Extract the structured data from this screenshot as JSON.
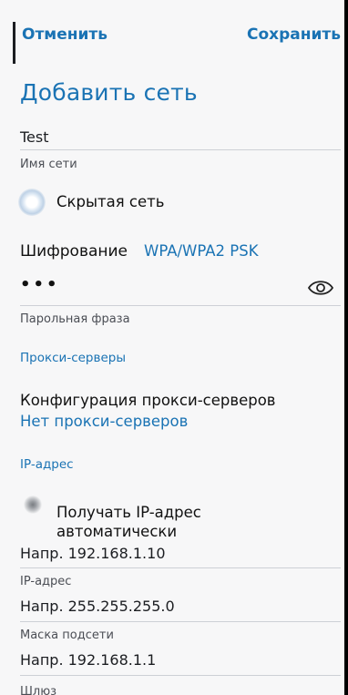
{
  "header": {
    "cancel_label": "Отменить",
    "save_label": "Сохранить"
  },
  "page_title": "Добавить сеть",
  "network_name": {
    "value": "Test",
    "caption": "Имя сети"
  },
  "hidden_network": {
    "label": "Скрытая сеть",
    "checked": false
  },
  "encryption": {
    "label": "Шифрование",
    "value": "WPA/WPA2 PSK"
  },
  "password": {
    "value": "•••",
    "caption": "Парольная фраза",
    "toggle_icon": "eye-icon"
  },
  "proxy": {
    "section_title": "Прокси-серверы",
    "label": "Конфигурация прокси-серверов",
    "value": "Нет прокси-серверов"
  },
  "ip": {
    "section_title": "IP-адрес",
    "auto_label_line1": "Получать IP-адрес",
    "auto_label_line2": "автоматически",
    "address_placeholder": "Напр. 192.168.1.10",
    "address_caption": "IP-адрес",
    "mask_placeholder": "Напр. 255.255.255.0",
    "mask_caption": "Маска подсети",
    "gateway_placeholder": "Напр. 192.168.1.1",
    "gateway_caption": "Шлюз"
  },
  "colors": {
    "accent": "#1a73b4",
    "background": "#f7f7f8",
    "text": "#111111"
  }
}
